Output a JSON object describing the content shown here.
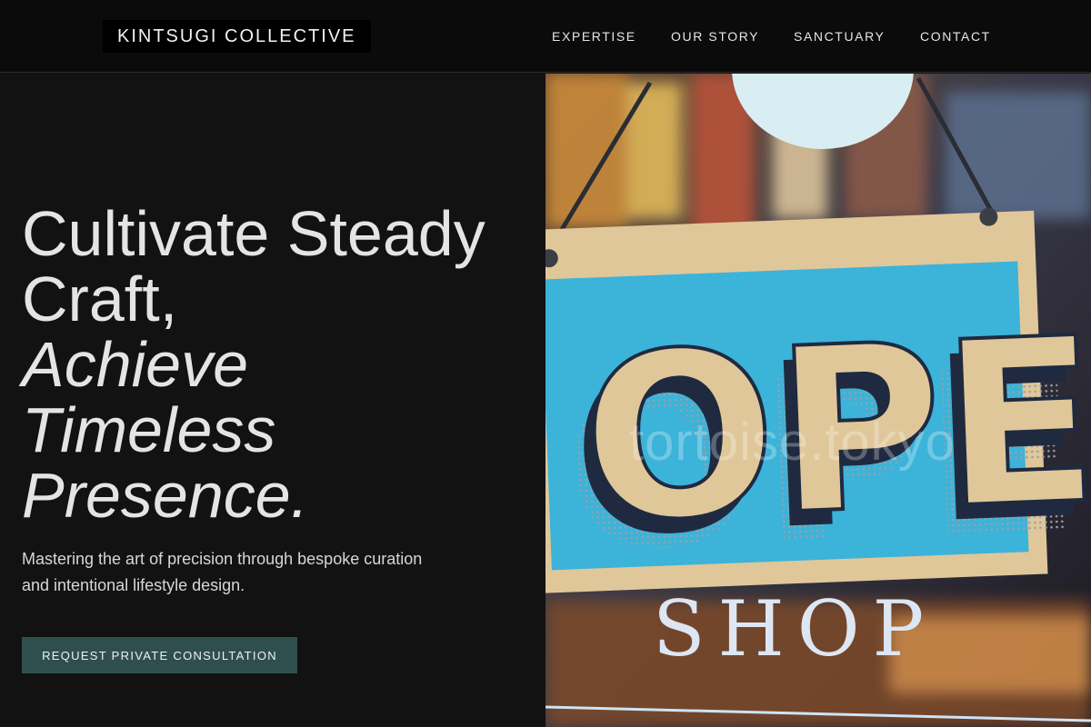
{
  "header": {
    "logo": "KINTSUGI COLLECTIVE",
    "nav": [
      "EXPERTISE",
      "OUR STORY",
      "SANCTUARY",
      "CONTACT"
    ]
  },
  "hero": {
    "headline_line1": "Cultivate Steady",
    "headline_line2": "Craft,",
    "headline_italic_line1": "Achieve",
    "headline_italic_line2": "Timeless",
    "headline_italic_line3": "Presence.",
    "subtext": "Mastering the art of precision through bespoke curation and intentional lifestyle design.",
    "cta_label": "REQUEST PRIVATE CONSULTATION"
  },
  "image": {
    "sign_text": "OPEN",
    "door_text": "SHOP",
    "watermark": "tortoise.tokyo"
  },
  "colors": {
    "background": "#121212",
    "header": "#0b0b0b",
    "cta": "#2f4f4f",
    "sign_blue": "#3cb3d9",
    "sign_cream": "#e0c79a"
  }
}
